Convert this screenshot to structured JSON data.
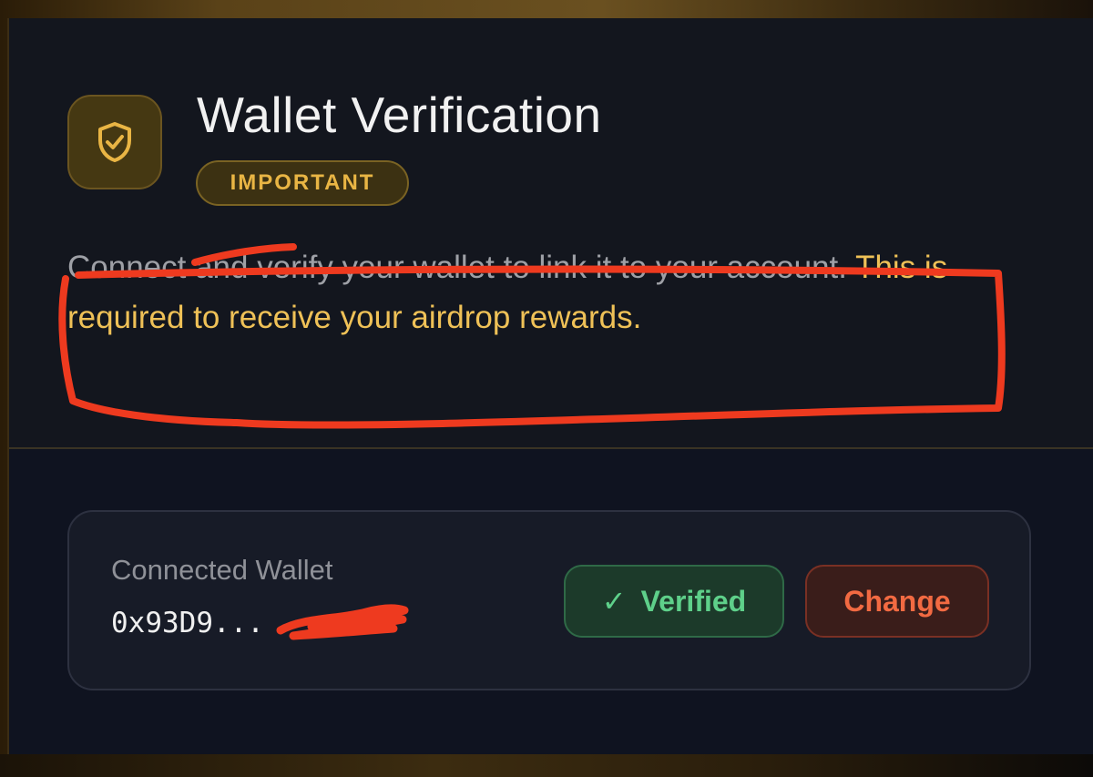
{
  "header": {
    "title": "Wallet Verification",
    "badge": "IMPORTANT"
  },
  "description": {
    "plain": "Connect and verify your wallet to link it to your account. ",
    "highlight": "This is required to receive your airdrop rewards."
  },
  "wallet": {
    "label": "Connected Wallet",
    "address": "0x93D9...",
    "verified_label": "Verified",
    "verified_check": "✓",
    "change_label": "Change"
  },
  "icons": {
    "verification": "shield-check-icon",
    "verified": "check-icon"
  },
  "colors": {
    "accent_gold": "#efc157",
    "verified_green": "#5ed08a",
    "change_red": "#f26a42",
    "annotation_red": "#ee3a1f"
  }
}
